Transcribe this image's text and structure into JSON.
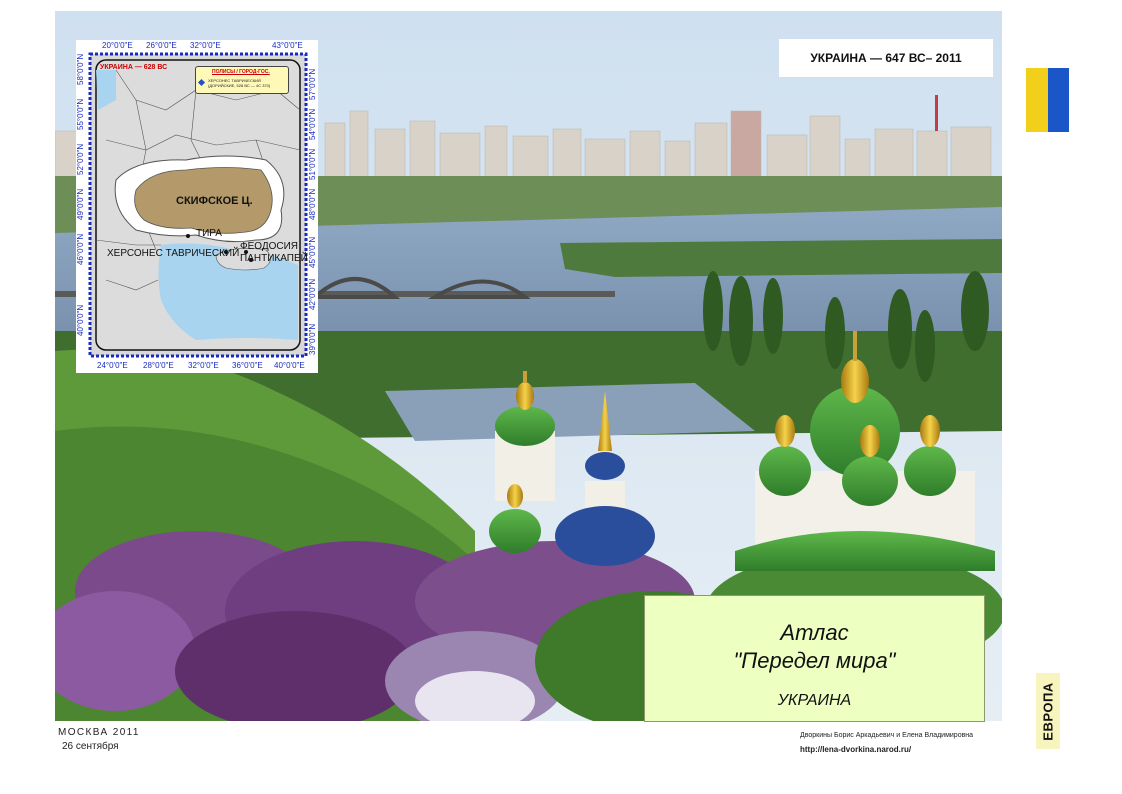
{
  "header": {
    "title": "УКРАИНА — 647 ВС– 2011"
  },
  "atlas": {
    "line1": "Атлас",
    "line2": "\"Передел мира\"",
    "country": "УКРАИНА"
  },
  "side": {
    "region": "ЕВРОПА"
  },
  "footer": {
    "city_year": "МОСКВА   2011",
    "date": "26 сентября",
    "authors": "Дворкины Борис Аркадьевич и Елена Владимировна",
    "url": "http://lena-dvorkina.narod.ru/"
  },
  "inset_map": {
    "tag": "УКРАИНА — 628 ВС",
    "legend_title": "ПОЛИСЫ / ГОРОД-ГОС.",
    "legend_text": "ХЕРСОНЕС ТАВРИЧЕСКИЙ (ДОРИЙСКИЕ, 528 ВС — 4С 370)",
    "labels": {
      "scythia": "СКИФСКОЕ Ц.",
      "chersonesus": "ХЕРСОНЕС ТАВРИЧЕСКИЙ",
      "tira": "ТИРА",
      "feodosia": "ФЕОДОСИЯ",
      "panticapaeum": "ПАНТИКАПЕЙ"
    },
    "top_coords": [
      "20°0'0\"E",
      "26°0'0\"E",
      "32°0'0\"E",
      "43°0'0\"E"
    ],
    "bottom_coords": [
      "24°0'0\"E",
      "28°0'0\"E",
      "32°0'0\"E",
      "36°0'0\"E",
      "40°0'0\"E"
    ],
    "left_coords": [
      "58°0'0\"N",
      "55°0'0\"N",
      "52°0'0\"N",
      "49°0'0\"N",
      "46°0'0\"N",
      "40°0'0\"N"
    ],
    "right_coords": [
      "57°0'0\"N",
      "54°0'0\"N",
      "51°0'0\"N",
      "48°0'0\"N",
      "45°0'0\"N",
      "42°0'0\"N",
      "39°0'0\"N"
    ]
  },
  "colors": {
    "flag_blue": "#0a5cc8",
    "flag_yellow": "#f2cf1b",
    "atlas_bg": "#eeffc2",
    "europe_bg": "#f7f4bd",
    "scythia": "#b49a6a",
    "sea": "#a8d4f0",
    "coord_blue": "#1a2cbf"
  }
}
